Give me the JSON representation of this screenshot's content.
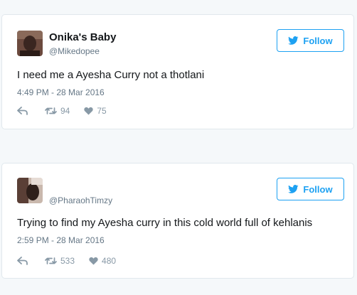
{
  "tweets": [
    {
      "display_name": "Onika's Baby",
      "handle": "@Mikedopee",
      "follow_label": "Follow",
      "text": "I need me a Ayesha Curry not a thotlani",
      "timestamp": "4:49 PM - 28 Mar 2016",
      "retweets": "94",
      "likes": "75"
    },
    {
      "display_name": "",
      "handle": "@PharaohTimzy",
      "follow_label": "Follow",
      "text": "Trying to find my Ayesha curry in this cold world full of kehlanis",
      "timestamp": "2:59 PM - 28 Mar 2016",
      "retweets": "533",
      "likes": "480"
    }
  ],
  "colors": {
    "accent": "#1da1f2",
    "muted": "#657786",
    "icon": "#8899a6",
    "card_border": "#e1e8ed",
    "background": "#f5f8fa"
  },
  "icons": [
    "twitter-bird-icon",
    "reply-icon",
    "retweet-icon",
    "heart-icon"
  ]
}
